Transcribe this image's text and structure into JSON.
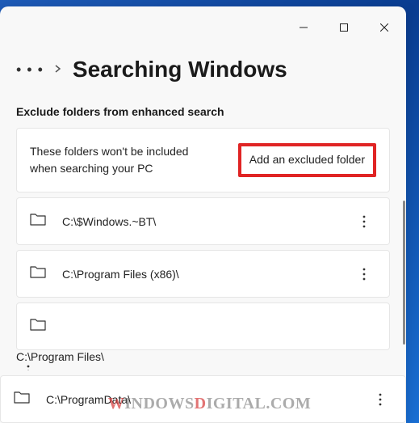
{
  "titlebar": {
    "minimize": "min",
    "maximize": "max",
    "close": "close"
  },
  "breadcrumb": {
    "dots": "• • •",
    "title": "Searching Windows"
  },
  "section": {
    "heading": "Exclude folders from enhanced search",
    "description": "These folders won't be included when searching your PC",
    "add_button": "Add an excluded folder"
  },
  "folders": [
    {
      "path": "C:\\$Windows.~BT\\"
    },
    {
      "path": "C:\\Program Files (x86)\\"
    },
    {
      "path": "C:\\Program Files\\"
    },
    {
      "path": "C:\\ProgramData\\"
    }
  ],
  "watermark": {
    "w": "W",
    "indows": "INDOWS",
    "d": "D",
    "igital": "IGITAL",
    "suffix": ".COM"
  }
}
